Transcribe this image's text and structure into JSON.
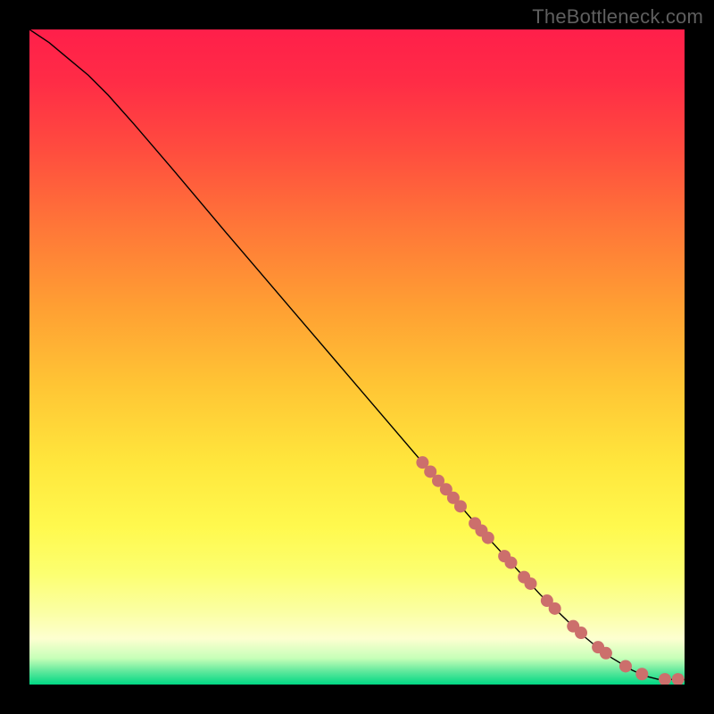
{
  "watermark": "TheBottleneck.com",
  "chart_data": {
    "type": "line",
    "title": "",
    "xlabel": "",
    "ylabel": "",
    "xlim": [
      0,
      100
    ],
    "ylim": [
      0,
      100
    ],
    "grid": false,
    "legend": false,
    "gradient_stops": [
      {
        "offset": 0.0,
        "color": "#ff1f4a"
      },
      {
        "offset": 0.08,
        "color": "#ff2c46"
      },
      {
        "offset": 0.18,
        "color": "#ff4b3f"
      },
      {
        "offset": 0.3,
        "color": "#ff7638"
      },
      {
        "offset": 0.42,
        "color": "#ff9e33"
      },
      {
        "offset": 0.54,
        "color": "#ffc434"
      },
      {
        "offset": 0.66,
        "color": "#ffe63c"
      },
      {
        "offset": 0.76,
        "color": "#fff94e"
      },
      {
        "offset": 0.83,
        "color": "#fcff70"
      },
      {
        "offset": 0.89,
        "color": "#fbffa4"
      },
      {
        "offset": 0.93,
        "color": "#fdffd0"
      },
      {
        "offset": 0.96,
        "color": "#c6ffb8"
      },
      {
        "offset": 0.98,
        "color": "#5fe89c"
      },
      {
        "offset": 1.0,
        "color": "#00d884"
      }
    ],
    "series": [
      {
        "name": "curve",
        "type": "line",
        "color": "#000000",
        "width": 1.4,
        "x": [
          0,
          3,
          6,
          9,
          12,
          16,
          22,
          30,
          40,
          50,
          60,
          70,
          78,
          84,
          88,
          92,
          94,
          96,
          100
        ],
        "y": [
          100,
          98,
          95.5,
          93,
          90,
          85.5,
          78.5,
          69,
          57.3,
          45.6,
          33.9,
          22.4,
          13.7,
          7.9,
          4.6,
          2.2,
          1.3,
          0.8,
          0.75
        ]
      },
      {
        "name": "dots",
        "type": "scatter",
        "color": "#cc6f6c",
        "radius": 7,
        "x": [
          60.0,
          61.2,
          62.4,
          63.6,
          64.7,
          65.8,
          68.0,
          69.0,
          70.0,
          72.5,
          73.5,
          75.5,
          76.5,
          79.0,
          80.2,
          83.0,
          84.2,
          86.8,
          88.0,
          91.0,
          93.5,
          97.0,
          99.0
        ],
        "y": [
          33.9,
          32.5,
          31.1,
          29.8,
          28.5,
          27.2,
          24.6,
          23.5,
          22.4,
          19.6,
          18.6,
          16.4,
          15.4,
          12.8,
          11.6,
          8.9,
          7.9,
          5.7,
          4.8,
          2.8,
          1.6,
          0.8,
          0.8
        ]
      }
    ]
  }
}
